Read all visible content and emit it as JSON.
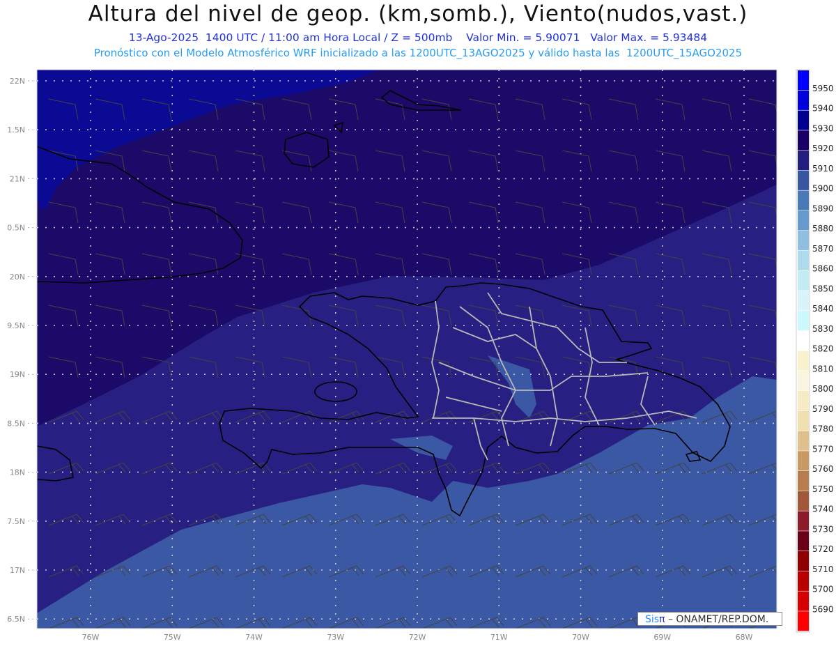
{
  "header": {
    "title": "Altura del nivel de geop. (km,somb.), Viento(nudos,vast.)",
    "subtitle_1": "13-Ago-2025  1400 UTC / 11:00 am Hora Local / Z = 500mb    Valor Min. = 5.90071   Valor Max. = 5.93484",
    "subtitle_2": "Pronóstico con el Modelo Atmosférico WRF inicializado a las 1200UTC_13AGO2025 y válido hasta las  1200UTC_15AGO2025"
  },
  "map": {
    "lat_labels": [
      "22N",
      "1.5N",
      "21N",
      "0.5N",
      "20N",
      "9.5N",
      "19N",
      "8.5N",
      "18N",
      "7.5N",
      "17N",
      "6.5N"
    ],
    "lon_labels": [
      "76W",
      "75W",
      "74W",
      "73W",
      "72W",
      "71W",
      "70W",
      "69W",
      "68W"
    ],
    "fill_colors": {
      "b5930": "#0a0a94",
      "b5920": "#1c0a68",
      "b5910": "#272082",
      "b5900": "#3a58a3"
    }
  },
  "colorbar": {
    "labels": [
      "5950",
      "5940",
      "5930",
      "5920",
      "5910",
      "5900",
      "5890",
      "5880",
      "5870",
      "5860",
      "5850",
      "5840",
      "5830",
      "5820",
      "5810",
      "5800",
      "5790",
      "5780",
      "5770",
      "5760",
      "5750",
      "5740",
      "5730",
      "5720",
      "5710",
      "5700",
      "5690"
    ],
    "colors": [
      "#0000ff",
      "#0000dd",
      "#00008f",
      "#1a0066",
      "#221e7e",
      "#3a56a0",
      "#4a7ab5",
      "#6699cc",
      "#8ebfe0",
      "#afdcec",
      "#c2ecf3",
      "#d8f4f8",
      "#ccfafc",
      "#ffffff",
      "#f8f2cf",
      "#fbf4e0",
      "#f7ebc5",
      "#f0dfb0",
      "#dfc18d",
      "#c89a62",
      "#b87d4e",
      "#a0573a",
      "#8b1a2a",
      "#6a0018",
      "#900000",
      "#b80000",
      "#d80000",
      "#ff0000"
    ]
  },
  "credit": {
    "brand": "Sis",
    "pi": "π",
    "text": " – ONAMET/REP.DOM."
  }
}
